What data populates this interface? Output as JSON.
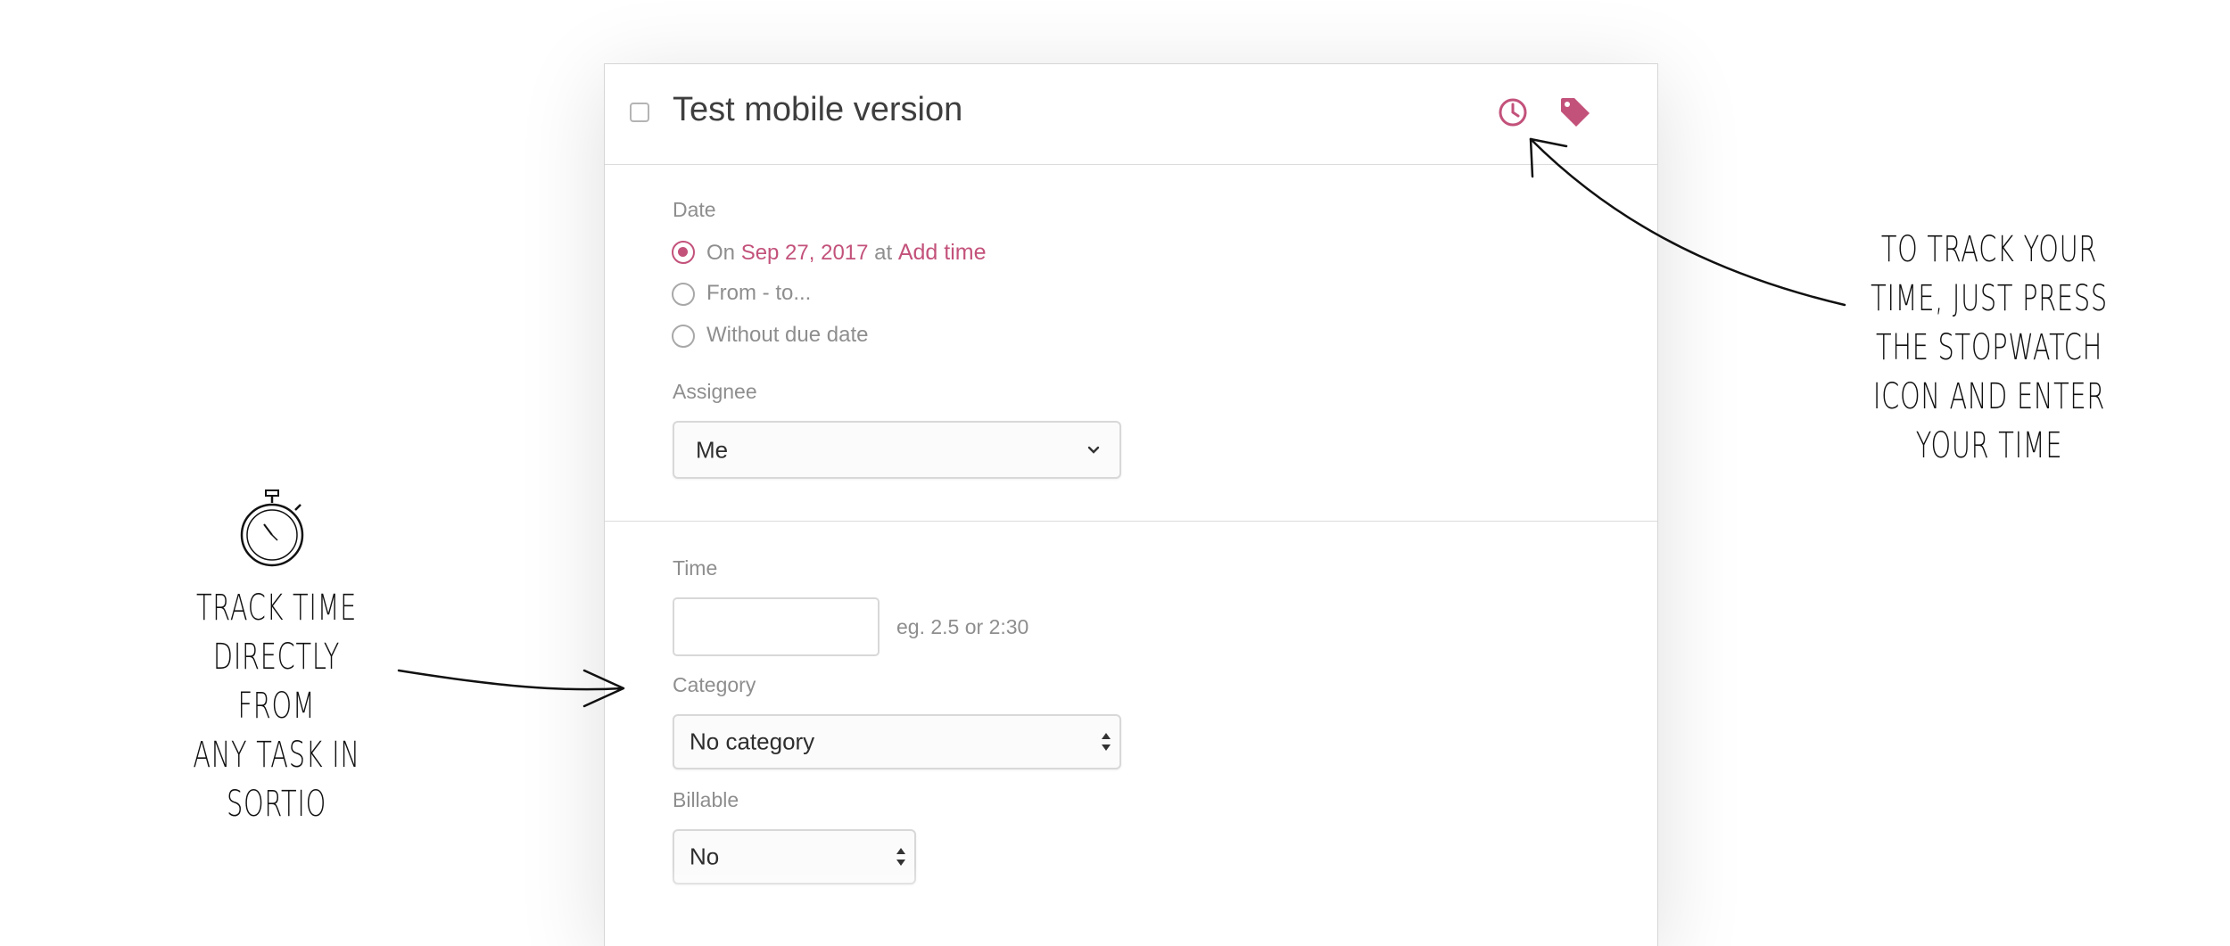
{
  "task": {
    "title": "Test mobile version",
    "icons": {
      "stopwatch": "clock-icon",
      "tag": "tag-icon"
    },
    "accent_color": "#c3527b"
  },
  "date": {
    "label": "Date",
    "options": [
      {
        "prefix": "On",
        "date": "Sep 27, 2017",
        "middle": "at",
        "action": "Add time",
        "selected": true
      },
      {
        "label": "From - to...",
        "selected": false
      },
      {
        "label": "Without due date",
        "selected": false
      }
    ]
  },
  "assignee": {
    "label": "Assignee",
    "value": "Me"
  },
  "time": {
    "label": "Time",
    "value": "",
    "hint": "eg. 2.5 or 2:30"
  },
  "category": {
    "label": "Category",
    "value": "No category"
  },
  "billable": {
    "label": "Billable",
    "value": "No"
  },
  "annotations": {
    "left": [
      "TRACK TIME",
      "DIRECTLY FROM",
      "ANY TASK IN",
      "SORTIO"
    ],
    "right": [
      "TO TRACK YOUR",
      "TIME, JUST PRESS",
      "THE STOPWATCH",
      "ICON AND ENTER",
      "YOUR TIME"
    ]
  }
}
